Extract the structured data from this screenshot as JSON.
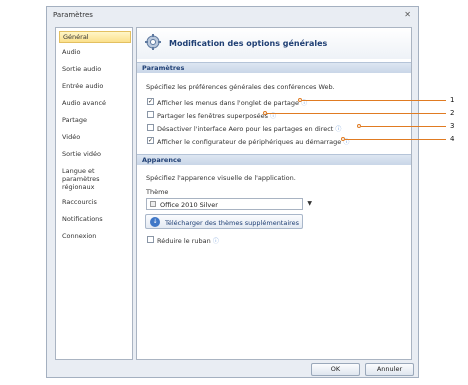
{
  "window": {
    "title": "Paramètres",
    "close_glyph": "✕"
  },
  "sidebar": {
    "items": [
      {
        "label": "Général",
        "active": true
      },
      {
        "label": "Audio"
      },
      {
        "label": "Sortie audio"
      },
      {
        "label": "Entrée audio"
      },
      {
        "label": "Audio avancé"
      },
      {
        "label": "Partage"
      },
      {
        "label": "Vidéo"
      },
      {
        "label": "Sortie vidéo"
      },
      {
        "label": "Langue et paramètres régionaux"
      },
      {
        "label": "Raccourcis"
      },
      {
        "label": "Notifications"
      },
      {
        "label": "Connexion"
      }
    ]
  },
  "header": {
    "title": "Modification des options générales",
    "icon": "gear-icon"
  },
  "parametres": {
    "heading": "Paramètres",
    "description": "Spécifiez les préférences générales des conférences Web.",
    "options": [
      {
        "label": "Afficher les menus dans l'onglet de partage",
        "checked": true
      },
      {
        "label": "Partager les fenêtres superposées",
        "checked": false
      },
      {
        "label": "Désactiver l'interface Aero pour les partages en direct",
        "checked": false
      },
      {
        "label": "Afficher le configurateur de périphériques au démarrage",
        "checked": true
      }
    ],
    "info_glyph": "ⓘ"
  },
  "apparence": {
    "heading": "Apparence",
    "description": "Spécifiez l'apparence visuelle de l'application.",
    "theme_label": "Thème",
    "theme_value": "Office 2010 Silver",
    "download_label": "Télécharger des thèmes supplémentaires",
    "reduce_ribbon_label": "Réduire le ruban",
    "reduce_ribbon_checked": false
  },
  "footer": {
    "ok_label": "OK",
    "cancel_label": "Annuler"
  },
  "callouts": [
    "1",
    "2",
    "3",
    "4"
  ],
  "colors": {
    "accent": "#1f3f74",
    "callout": "#e07b22",
    "active_item": "#fbe08c"
  }
}
